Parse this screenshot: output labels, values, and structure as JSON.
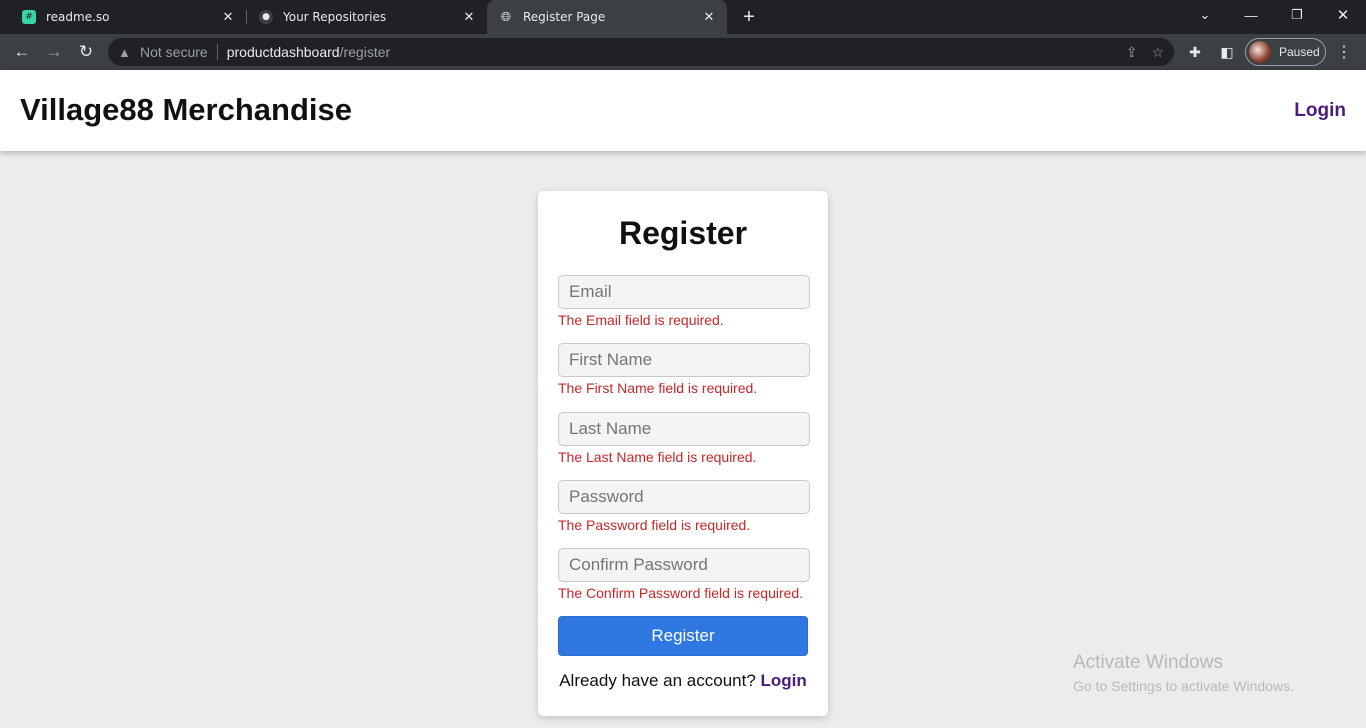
{
  "browser": {
    "tabs": [
      {
        "title": "readme.so",
        "icon": "readme-icon",
        "color": "#39d4a3"
      },
      {
        "title": "Your Repositories",
        "icon": "github-icon",
        "color": "#e8eaed"
      },
      {
        "title": "Register Page",
        "icon": "globe-icon",
        "color": "#e8eaed",
        "active": true
      }
    ],
    "address": {
      "security_label": "Not secure",
      "host": "productdashboard",
      "path": "/register"
    },
    "profile_status": "Paused"
  },
  "header": {
    "site_title": "Village88 Merchandise",
    "login_link": "Login"
  },
  "form": {
    "title": "Register",
    "fields": [
      {
        "placeholder": "Email",
        "value": "",
        "error": "The Email field is required."
      },
      {
        "placeholder": "First Name",
        "value": "",
        "error": "The First Name field is required."
      },
      {
        "placeholder": "Last Name",
        "value": "",
        "error": "The Last Name field is required."
      },
      {
        "placeholder": "Password",
        "value": "",
        "error": "The Password field is required."
      },
      {
        "placeholder": "Confirm Password",
        "value": "",
        "error": "The Confirm Password field is required."
      }
    ],
    "submit_label": "Register",
    "footer_text": "Already have an account?",
    "footer_link": "Login"
  },
  "watermark": {
    "line1": "Activate Windows",
    "line2": "Go to Settings to activate Windows."
  },
  "colors": {
    "accent": "#2f78e2",
    "link": "#4a1d7d",
    "error": "#c62828"
  }
}
